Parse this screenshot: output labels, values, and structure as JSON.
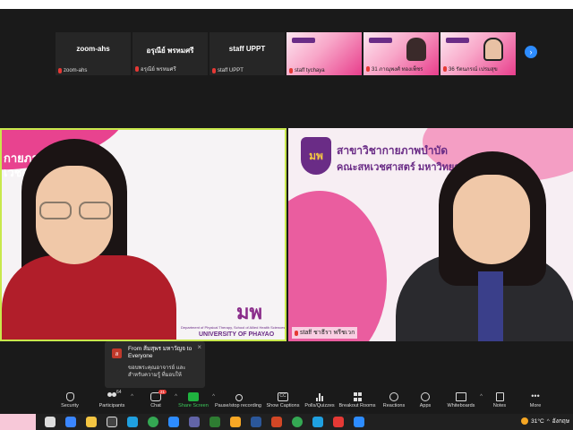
{
  "thumbnails": [
    {
      "name": "zoom-ahs",
      "label": "zoom-ahs",
      "type": "name"
    },
    {
      "name": "อรุณีย์ พรหมศรี",
      "label": "อรุณีย์ พรหมศรี",
      "type": "name"
    },
    {
      "name": "staff UPPT",
      "label": "staff UPPT",
      "type": "name"
    },
    {
      "label": "staff tychaya",
      "type": "video"
    },
    {
      "label": "31 ภาณุพงศ์ ทองเพ็ชร",
      "type": "video"
    },
    {
      "label": "36 รัตนภรณ์ เปรมสุข",
      "type": "video"
    }
  ],
  "main_left": {
    "banner": "กายภาพ\nเวชศาสต",
    "uni_logo": "มพ",
    "dept": "Department of Physical Therapy, School of Allied Health Sciences",
    "university": "UNIVERSITY OF PHAYAO"
  },
  "main_right": {
    "banner_line1": "สาขาวิชากายภาพบำบัด",
    "banner_line2": "คณะสหเวชศาสตร์ มหาวิทยา",
    "logo": "มพ",
    "name_tag": "staff ชาธีรา พรีชเวก"
  },
  "chat": {
    "avatar": "ส",
    "from": "From ส้มสุพร มหาวัญจ to Everyone",
    "message": "ขอบพระคุณอาจารย์ และ สำหรับความรู้ ที่มอบให้",
    "close": "×"
  },
  "toolbar": {
    "security": "Security",
    "participants": "Participants",
    "participants_count": "64",
    "chat": "Chat",
    "chat_badge": "21",
    "share_screen": "Share Screen",
    "record": "Pause/stop recording",
    "captions": "Show Captions",
    "polls": "Polls/Quizzes",
    "breakout": "Breakout Rooms",
    "reactions": "Reactions",
    "apps": "Apps",
    "whiteboards": "Whiteboards",
    "notes": "Notes",
    "more": "More"
  },
  "taskbar": {
    "temperature": "31°C",
    "language": "อังกฤษ"
  },
  "colors": {
    "accent_pink": "#e8438f",
    "active_speaker": "#c8e84c",
    "share_green": "#1fb33f",
    "zoom_blue": "#2d8cff"
  }
}
